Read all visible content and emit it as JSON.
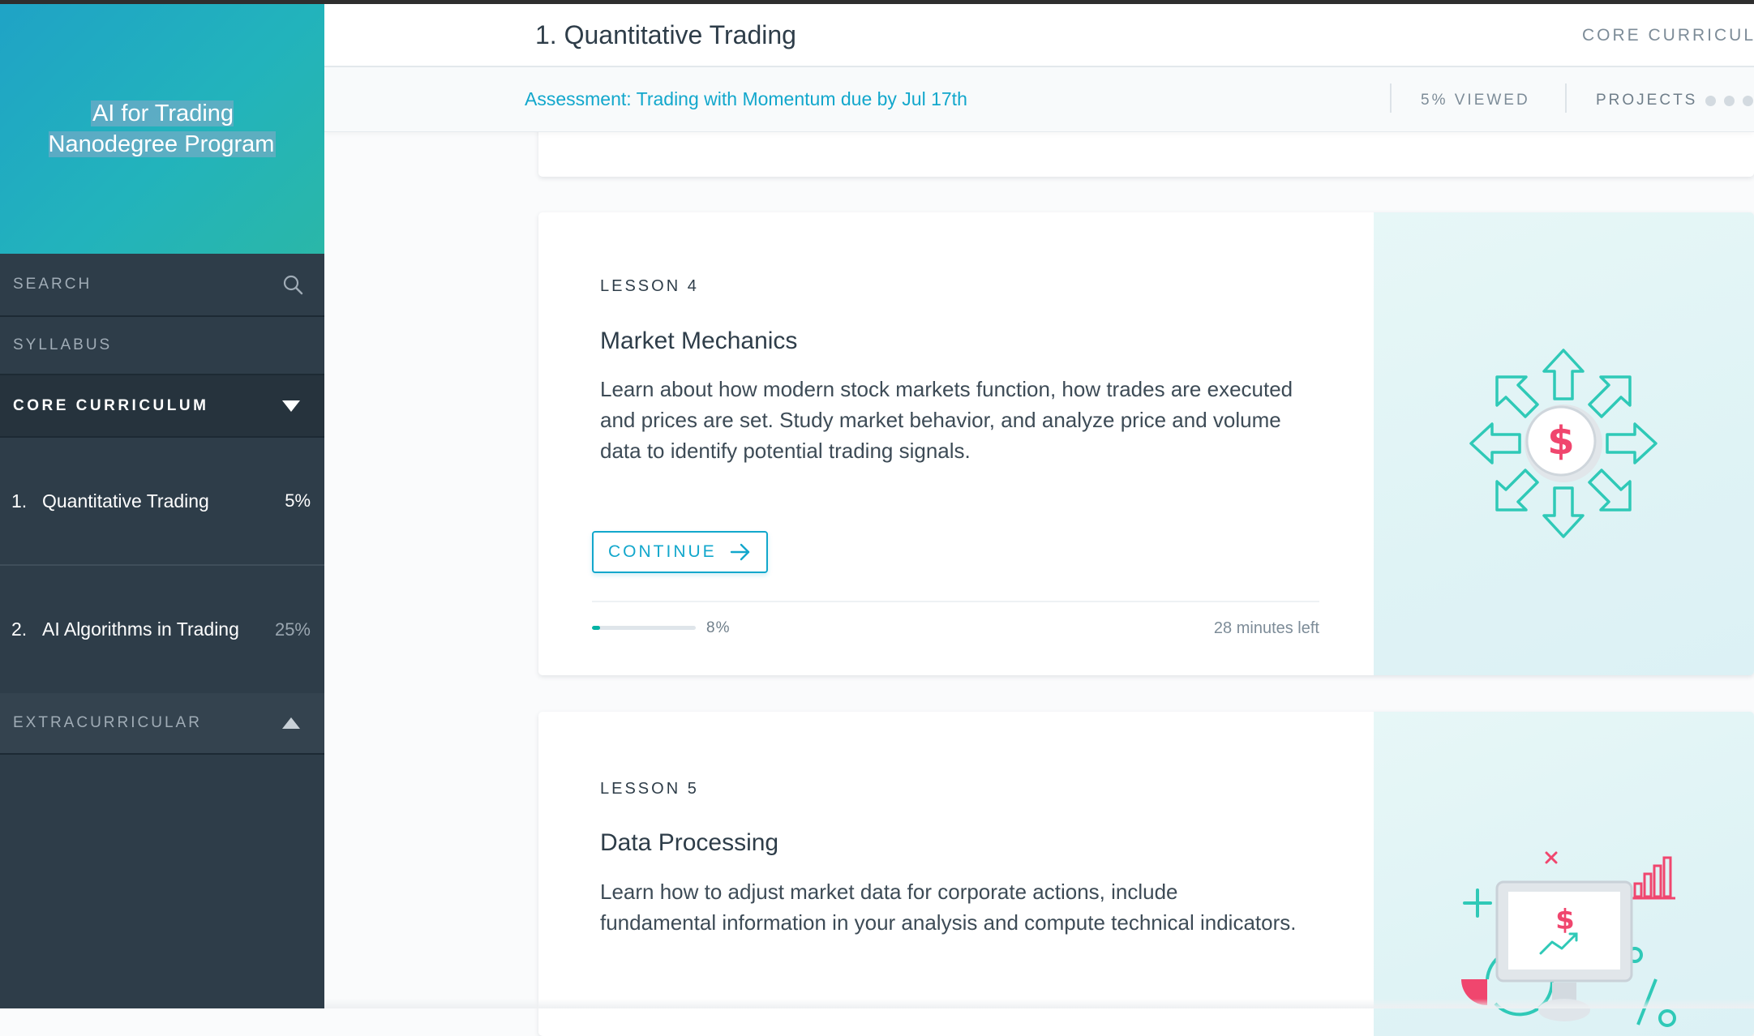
{
  "sidebar": {
    "program_title": "AI for Trading Nanodegree Program",
    "search_label": "SEARCH",
    "syllabus_label": "SYLLABUS",
    "core_label": "CORE CURRICULUM",
    "extra_label": "EXTRACURRICULAR",
    "lessons": [
      {
        "number": "1.",
        "title": "Quantitative Trading",
        "percent": "5%"
      },
      {
        "number": "2.",
        "title": "AI Algorithms in Trading",
        "percent": "25%"
      }
    ]
  },
  "header": {
    "title": "1. Quantitative Trading",
    "section": "CORE CURRICULUM"
  },
  "subheader": {
    "assessment": "Assessment: Trading with Momentum due by Jul 17th",
    "viewed": "5% VIEWED",
    "projects": "PROJECTS"
  },
  "cards": [
    {
      "label": "LESSON 4",
      "title": "Market Mechanics",
      "description": "Learn about how modern stock markets function, how trades are executed and prices are set. Study market behavior, and analyze price and volume data to identify potential trading signals.",
      "button": "CONTINUE",
      "progress": 0.08,
      "progress_label": "8%",
      "time_left": "28 minutes left",
      "art_icon": "market-arrows-dollar-icon"
    },
    {
      "label": "LESSON 5",
      "title": "Data Processing",
      "description": "Learn how to adjust market data for corporate actions, include fundamental information in your analysis and compute technical indicators.",
      "art_icon": "monitor-chart-dollar-icon"
    }
  ],
  "colors": {
    "accent": "#12a7cc",
    "sidebar_bg": "#2e3d49",
    "progress": "#02b3a4",
    "dollar": "#f0466e",
    "art_teal": "#2fc9b7"
  }
}
